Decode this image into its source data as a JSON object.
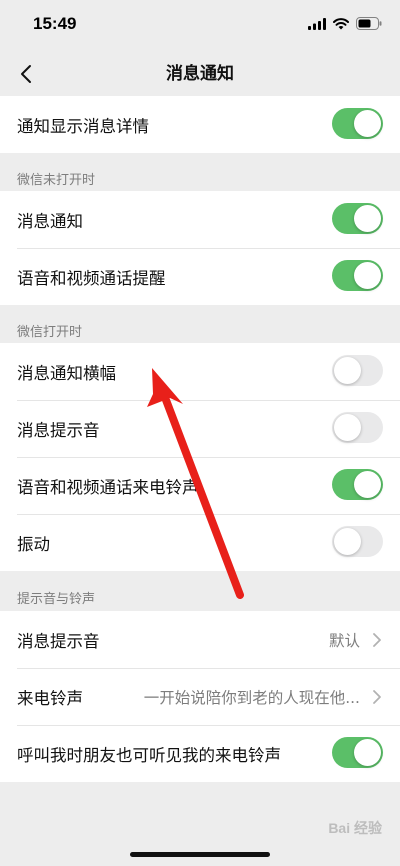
{
  "status_bar": {
    "time": "15:49"
  },
  "nav": {
    "title": "消息通知"
  },
  "top_group": {
    "rows": [
      {
        "label": "通知显示消息详情",
        "toggle": "on"
      }
    ]
  },
  "section_wechat_closed": {
    "header": "微信未打开时",
    "rows": [
      {
        "label": "消息通知",
        "toggle": "on"
      },
      {
        "label": "语音和视频通话提醒",
        "toggle": "on"
      }
    ]
  },
  "section_wechat_open": {
    "header": "微信打开时",
    "rows": [
      {
        "label": "消息通知横幅",
        "toggle": "off"
      },
      {
        "label": "消息提示音",
        "toggle": "off"
      },
      {
        "label": "语音和视频通话来电铃声",
        "toggle": "on"
      },
      {
        "label": "振动",
        "toggle": "off"
      }
    ]
  },
  "section_sounds": {
    "header": "提示音与铃声",
    "rows": [
      {
        "label": "消息提示音",
        "value": "默认"
      },
      {
        "label": "来电铃声",
        "value": "一开始说陪你到老的人现在他..."
      },
      {
        "label": "呼叫我时朋友也可听见我的来电铃声",
        "toggle": "on"
      }
    ]
  },
  "watermark": {
    "text": "Bai 经验"
  },
  "colors": {
    "switch_on": "#5bbf68",
    "switch_off": "#e9e9ea",
    "arrow": "#e8201a",
    "background": "#ededed"
  },
  "icons": [
    "back-chevron-icon",
    "signal-icon",
    "wifi-icon",
    "battery-icon",
    "chevron-right-icon"
  ]
}
